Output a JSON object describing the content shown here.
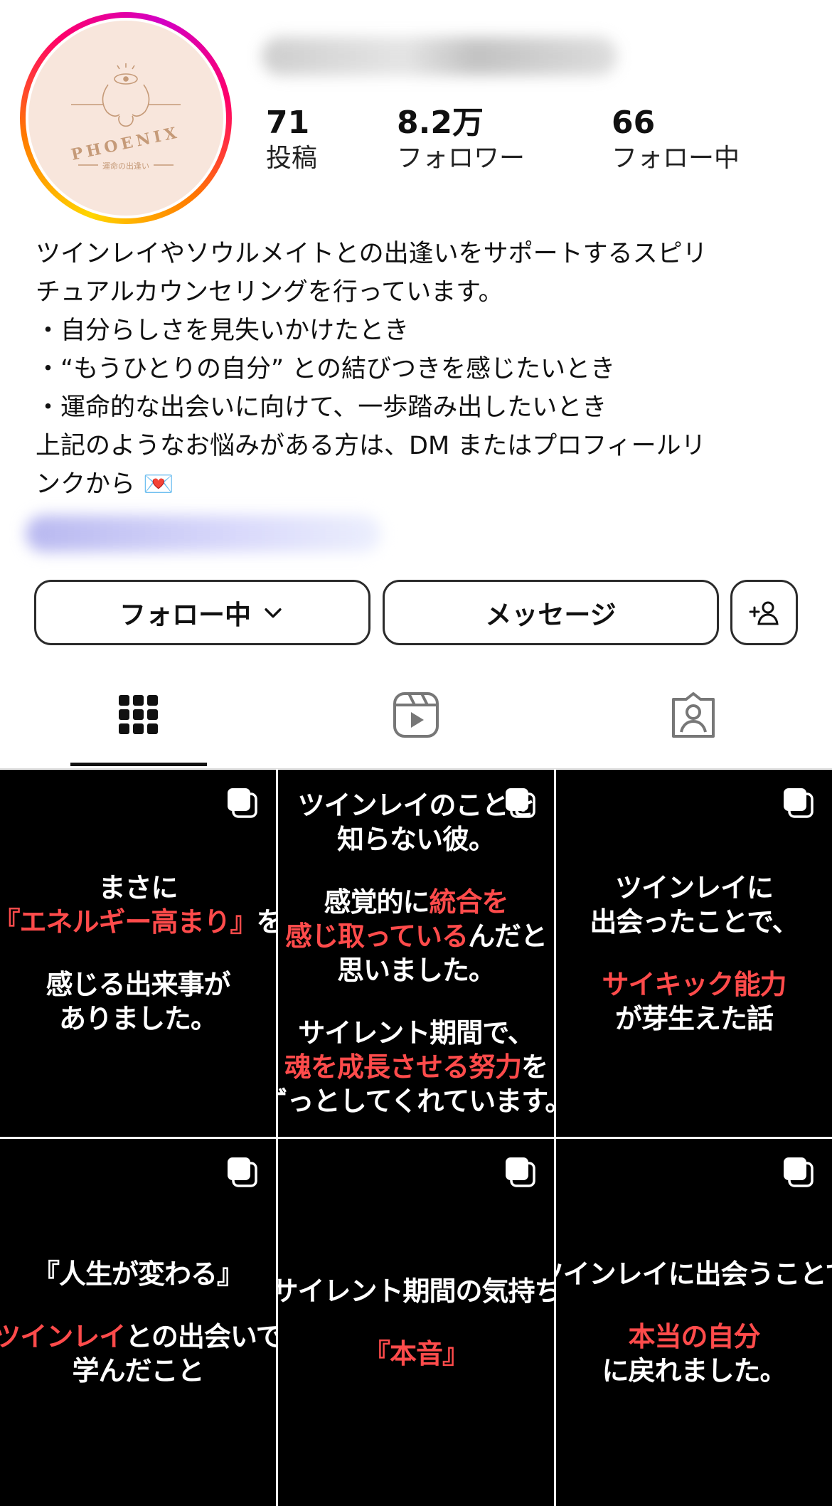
{
  "profile": {
    "avatar_text": "PHOENIX",
    "avatar_subtext": "運命の出逢い",
    "stats": [
      {
        "num": "71",
        "label": "投稿"
      },
      {
        "num": "8.2万",
        "label": "フォロワー"
      },
      {
        "num": "66",
        "label": "フォロー中"
      }
    ],
    "bio": "ツインレイやソウルメイトとの出逢いをサポートするスピリ\nチュアルカウンセリングを行っています。\n・自分らしさを見失いかけたとき\n・“もうひとりの自分” との結びつきを感じたいとき\n・運命的な出会いに向けて、一歩踏み出したいとき\n上記のようなお悩みがある方は、DM またはプロフィールリ\nンクから 💌"
  },
  "actions": {
    "follow_label": "フォロー中",
    "message_label": "メッセージ"
  },
  "tabs": [
    {
      "icon": "grid-icon",
      "active": true
    },
    {
      "icon": "reels-icon",
      "active": false
    },
    {
      "icon": "tagged-icon",
      "active": false
    }
  ],
  "posts": [
    {
      "lines": [
        {
          "t": "まさに"
        },
        {
          "t": "『エネルギー高まり』を",
          "red": "『エネルギー高まり』"
        },
        {
          "spacer": true
        },
        {
          "t": "感じる出来事が"
        },
        {
          "t": "ありました。"
        }
      ]
    },
    {
      "lines": [
        {
          "t": "ツインレイのことを"
        },
        {
          "t": "知らない彼。"
        },
        {
          "spacer": true
        },
        {
          "t": "感覚的に統合を",
          "red": "統合を"
        },
        {
          "t": "感じ取っているんだと",
          "red": "感じ取っている"
        },
        {
          "t": "思いました。"
        },
        {
          "spacer": true
        },
        {
          "t": "サイレント期間で、"
        },
        {
          "t": "魂を成長させる努力を",
          "red": "魂を成長させる努力"
        },
        {
          "t": "ずっとしてくれています。"
        }
      ]
    },
    {
      "lines": [
        {
          "t": "ツインレイに"
        },
        {
          "t": "出会ったことで、"
        },
        {
          "spacer": true
        },
        {
          "t": "サイキック能力",
          "red": "サイキック能力"
        },
        {
          "t": "が芽生えた話"
        }
      ]
    },
    {
      "lines": [
        {
          "t": "『人生が変わる』"
        },
        {
          "spacer": true
        },
        {
          "t": "ツインレイとの出会いで",
          "red": "ツインレイ"
        },
        {
          "t": "学んだこと"
        }
      ]
    },
    {
      "lines": [
        {
          "t": "サイレント期間の気持ち"
        },
        {
          "spacer": true
        },
        {
          "t": "『本音』",
          "red": "『本音』"
        }
      ]
    },
    {
      "lines": [
        {
          "t": "ツインレイに出会うことで"
        },
        {
          "spacer": true
        },
        {
          "t": "本当の自分",
          "red": "本当の自分"
        },
        {
          "t": "に戻れました。"
        }
      ]
    }
  ],
  "colors": {
    "accent_red": "#ff4b4b",
    "tile_bg": "#000000",
    "avatar_bg": "#f8e6dc"
  }
}
